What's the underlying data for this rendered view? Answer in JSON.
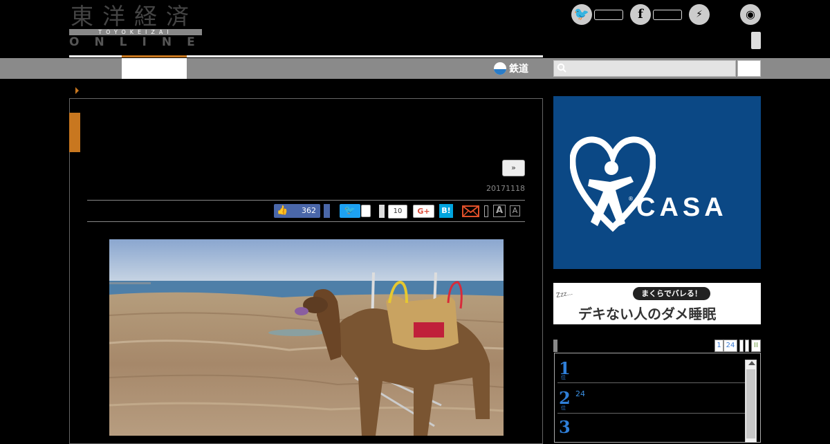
{
  "header": {
    "logo_kanji": "東洋経済",
    "logo_romaji": "TOYOKEIZAI",
    "logo_online": "ONLINE",
    "social": [
      {
        "name": "twitter",
        "glyph": "🐦"
      },
      {
        "name": "facebook",
        "glyph": "f"
      },
      {
        "name": "messenger",
        "glyph": "⚡"
      },
      {
        "name": "rss",
        "glyph": "◉"
      }
    ]
  },
  "nav": {
    "rail_label": "鉄道",
    "search_placeholder": ""
  },
  "article": {
    "next_label": "»",
    "date": "20171118",
    "share": {
      "facebook_like_count": "362",
      "tweet_glyph": "🐦",
      "gplus_count": "10",
      "gplus_label": "G+",
      "hatena_label": "B!",
      "font_large": "A",
      "font_small": "A"
    }
  },
  "sidebar": {
    "ad_casa_label": "CASA",
    "ad_casa_mark": "®",
    "ad_sleep_pill": "まくらでバレる！",
    "ad_sleep_text": "デキない人のダメ睡眠",
    "ad_sleep_zzz": "Zzz...",
    "ranking_tabs": [
      "1",
      "24",
      "",
      "",
      "II"
    ],
    "ranking": [
      {
        "rank": "1",
        "suffix": "位",
        "text": ""
      },
      {
        "rank": "2",
        "suffix": "位",
        "text": "24"
      },
      {
        "rank": "3",
        "suffix": "位",
        "text": ""
      }
    ]
  },
  "colors": {
    "accent_orange": "#c8771f",
    "nav_gray": "#8a8a8a",
    "casa_blue": "#0b4885",
    "rank_blue": "#2f7fd9"
  }
}
